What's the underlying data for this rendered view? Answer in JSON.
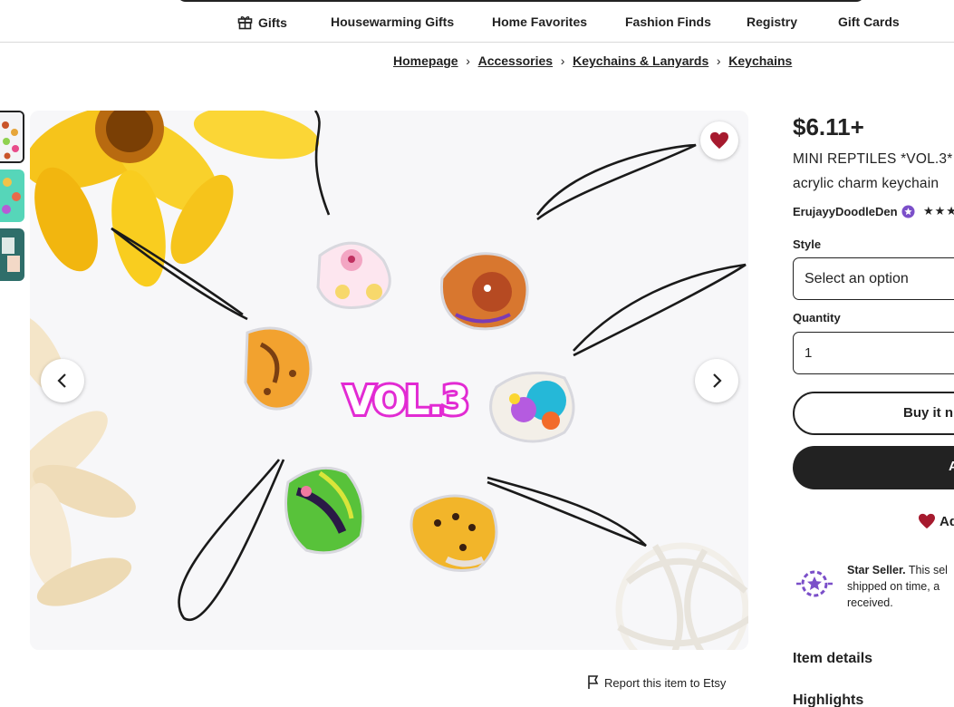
{
  "nav": {
    "items": [
      "Gifts",
      "Housewarming Gifts",
      "Home Favorites",
      "Fashion Finds",
      "Registry",
      "Gift Cards"
    ]
  },
  "breadcrumb": [
    "Homepage",
    "Accessories",
    "Keychains & Lanyards",
    "Keychains"
  ],
  "gallery": {
    "overlay_text": "VOL.3",
    "thumb_count": 3
  },
  "report_link": "Report this item to Etsy",
  "product": {
    "price": "$6.11+",
    "title_line1": "MINI REPTILES *VOL.3*",
    "title_line2": "acrylic charm keychain",
    "shop_name": "ErujayyDoodleDen",
    "rating_stars": "★★★",
    "style_label": "Style",
    "style_value": "Select an option",
    "quantity_label": "Quantity",
    "quantity_value": "1",
    "buy_now_label": "Buy it n",
    "add_cart_label": "A",
    "add_collection_label": "Ad",
    "star_seller_title": "Star Seller.",
    "star_seller_text": "This sel",
    "star_seller_line2": "shipped on time, a",
    "star_seller_line3": "received.",
    "item_details": "Item details",
    "highlights": "Highlights"
  },
  "colors": {
    "accent_heart": "#a61a2e",
    "star_seller_purple": "#7b4fc9",
    "text": "#222222"
  }
}
